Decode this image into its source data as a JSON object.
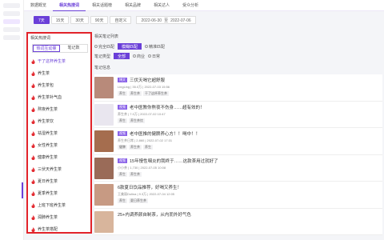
{
  "nav": {
    "tabs": [
      {
        "label": "数据概览",
        "active": false
      },
      {
        "label": "相关热搜词",
        "active": true
      },
      {
        "label": "相关话题榜",
        "active": false
      },
      {
        "label": "相关品牌",
        "active": false
      },
      {
        "label": "相关达人",
        "active": false
      },
      {
        "label": "受众分析",
        "active": false
      }
    ]
  },
  "filter": {
    "ranges": [
      {
        "label": "7天",
        "active": true
      },
      {
        "label": "15天",
        "active": false
      },
      {
        "label": "30天",
        "active": false
      },
      {
        "label": "90天",
        "active": false
      },
      {
        "label": "自定义",
        "active": false
      }
    ],
    "date_start": "2022-06-30",
    "date_sep": "至",
    "date_end": "2022-07-06"
  },
  "left_panel": {
    "title": "相关热搜词",
    "tabs": [
      {
        "label": "热词互动量",
        "active": true
      },
      {
        "label": "笔记数",
        "active": false
      }
    ],
    "items": [
      {
        "label": "干了这杯养生茶",
        "active": true
      },
      {
        "label": "养生茶",
        "active": false
      },
      {
        "label": "养生茶包",
        "active": false
      },
      {
        "label": "养生茶补气血",
        "active": false
      },
      {
        "label": "熬夜养生茶",
        "active": false
      },
      {
        "label": "养生茶饮",
        "active": false
      },
      {
        "label": "祛湿养生茶",
        "active": false
      },
      {
        "label": "女性养生茶",
        "active": false
      },
      {
        "label": "健康养生茶",
        "active": false
      },
      {
        "label": "三伏天养生茶",
        "active": false
      },
      {
        "label": "夏日养生茶",
        "active": false
      },
      {
        "label": "夏季养生茶",
        "active": false
      },
      {
        "label": "上班下班养生茶",
        "active": false
      },
      {
        "label": "润肺养生茶",
        "active": false
      },
      {
        "label": "养生茶搭配",
        "active": false
      },
      {
        "label": "气血养生茶",
        "active": false
      }
    ]
  },
  "right": {
    "title": "相关笔记列表",
    "match_options": [
      {
        "label": "完全匹配",
        "active": false
      },
      {
        "label": "模糊匹配",
        "active": true
      },
      {
        "label": "精准匹配",
        "active": false
      }
    ],
    "note_type_label": "笔记类型",
    "note_types": [
      {
        "label": "全部",
        "active": true
      },
      {
        "label": "商业",
        "active": false
      },
      {
        "label": "日常",
        "active": false
      }
    ],
    "notes_title": "笔记信息",
    "notes": [
      {
        "badge": "博文",
        "title": "三伏天喝它超舒服",
        "author": "LingLing",
        "likes": "35.0万",
        "date": "2022-07-03 15:56",
        "tags": [
          "养生",
          "养生茶",
          "干了这杯养生茶"
        ],
        "thumb": "#b88a7a"
      },
      {
        "badge": "视频",
        "title": "老中医教你熬夜不伤身……超有效的！",
        "author": "养生茶",
        "likes": "7.0万",
        "date": "2022-07-02 10:47",
        "tags": [
          "养生",
          "养生茶饮"
        ],
        "thumb": "#e9e6ef"
      },
      {
        "badge": "视频",
        "title": "老中医推的健脾养心方！！喝中！！",
        "author": "养生茶日常",
        "likes": "2,860",
        "date": "2022-07-02 17:31",
        "tags": [
          "健脾",
          "养生茶",
          "养生"
        ],
        "thumb": "#a56d4e"
      },
      {
        "badge": "视频",
        "title": "15年慢性咽炎的我终于……这款茶用过就好了",
        "author": "小小茶",
        "likes": "1,730",
        "date": "2022-07-05 10:08",
        "tags": [
          "养生",
          "养生茶"
        ],
        "thumb": "#9a6b58"
      },
      {
        "badge": "",
        "title": "6款夏日饮品推荐，好喝又养生！",
        "author": "王美丽Dolina",
        "likes": "9.3万",
        "date": "2022-07-04 12:05",
        "tags": [
          "养生",
          "夏日养生茶"
        ],
        "thumb": "#c79a83"
      },
      {
        "badge": "",
        "title": "25+内调养颜自制茶，从内而外好气色",
        "author": "",
        "likes": "",
        "date": "",
        "tags": [],
        "thumb": "#d8b59c"
      }
    ]
  },
  "colors": {
    "accent": "#6a3fd8",
    "highlight_border": "#e2232a"
  }
}
